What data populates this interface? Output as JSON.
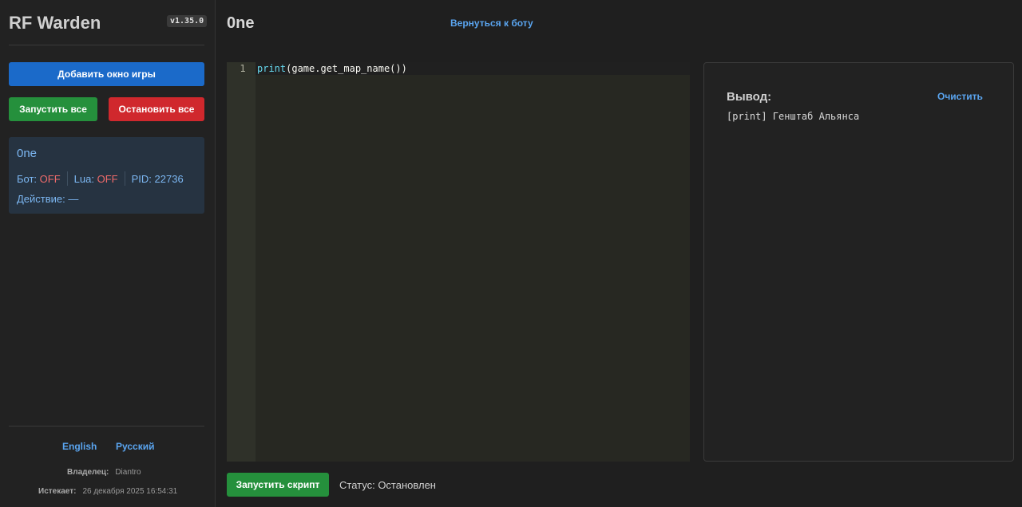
{
  "sidebar": {
    "brand": "RF Warden",
    "version": "v1.35.0",
    "add_window_label": "Добавить окно игры",
    "start_all_label": "Запустить все",
    "stop_all_label": "Остановить все",
    "instance": {
      "name": "0ne",
      "bot_label": "Бот:",
      "bot_value": "OFF",
      "lua_label": "Lua:",
      "lua_value": "OFF",
      "pid_label": "PID:",
      "pid_value": "22736",
      "action_label": "Действие:",
      "action_value": "—"
    },
    "languages": [
      "English",
      "Русский"
    ],
    "owner_label": "Владелец:",
    "owner_value": "Diantro",
    "expires_label": "Истекает:",
    "expires_value": "26 декабря 2025 16:54:31"
  },
  "main": {
    "title": "0ne",
    "back_link": "Вернуться к боту",
    "editor": {
      "line_number": "1",
      "code_keyword": "print",
      "code_rest": "(game.get_map_name())"
    },
    "output": {
      "title": "Вывод:",
      "clear_label": "Очистить",
      "lines": [
        "[print] Генштаб Альянса"
      ]
    },
    "run_script_label": "Запустить скрипт",
    "status_text": "Статус: Остановлен"
  },
  "colors": {
    "accent_blue": "#1b6ac9",
    "success_green": "#25903c",
    "danger_red": "#d0282d",
    "link_blue": "#5aa5f0",
    "off_red": "#f06b6b"
  }
}
